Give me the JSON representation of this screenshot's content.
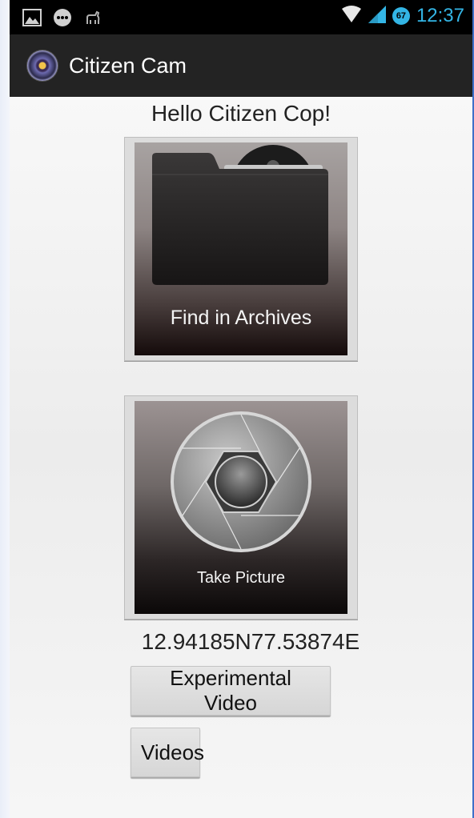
{
  "status_bar": {
    "left_icons": [
      "image-icon",
      "chat-bubble-icon",
      "android-debug-icon"
    ],
    "right_icons": [
      "wifi-icon",
      "cell-signal-icon"
    ],
    "battery_level": "67",
    "time": "12:37"
  },
  "action_bar": {
    "app_icon": "eye-icon",
    "title": "Citizen Cam"
  },
  "main": {
    "greeting": "Hello Citizen Cop!",
    "archive_tile": {
      "icon": "folder-icon",
      "label": "Find in Archives"
    },
    "camera_tile": {
      "icon": "camera-shutter-icon",
      "label": "Take Picture"
    },
    "coordinates": "12.94185N77.53874E",
    "experimental_video_button": "Experimental Video",
    "videos_button": "Videos"
  },
  "colors": {
    "status_accent": "#33b5e5",
    "action_bar": "#232323",
    "status_bar": "#000000"
  }
}
